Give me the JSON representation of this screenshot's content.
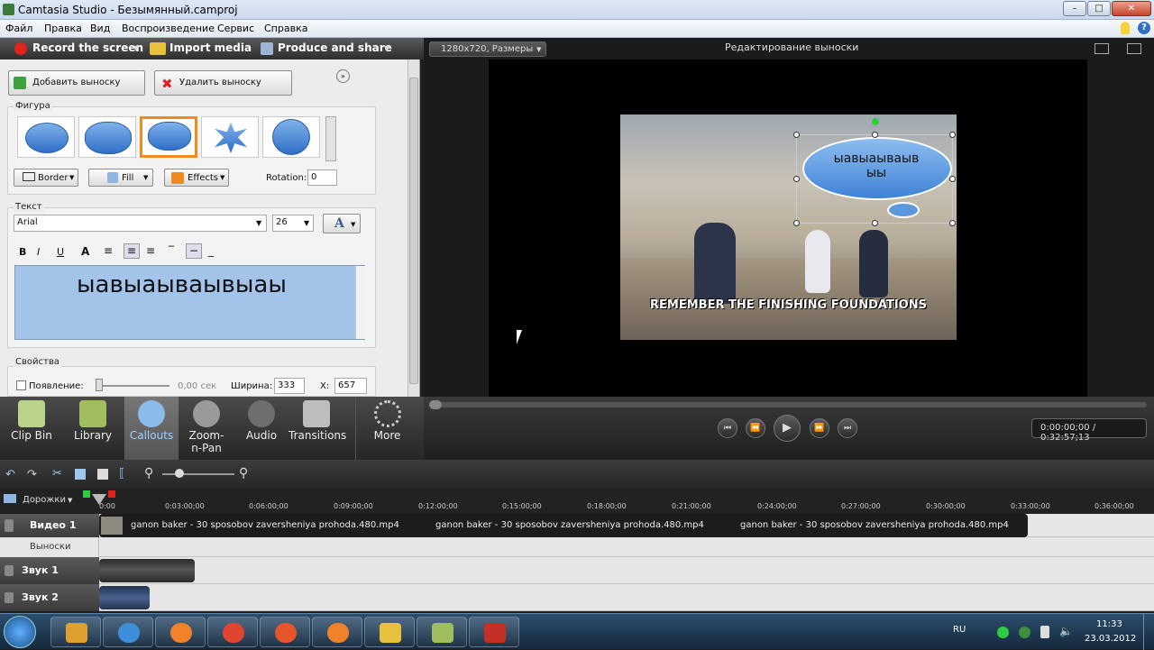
{
  "window": {
    "title": "Camtasia Studio - Безымянный.camproj"
  },
  "menu": [
    "Файл",
    "Правка",
    "Вид",
    "Воспроизведение",
    "Сервис",
    "Справка"
  ],
  "toolbar": {
    "record": "Record the screen",
    "import": "Import media",
    "produce": "Produce and share"
  },
  "callouts": {
    "add": "Добавить выноску",
    "remove": "Удалить выноску",
    "shape_group": "Фигура",
    "border": "Border",
    "fill": "Fill",
    "effects": "Effects",
    "rotation_label": "Rotation:",
    "rotation_value": "0",
    "text_group": "Текст",
    "font": "Arial",
    "font_size": "26",
    "text_value": "ыавыаываывыаы",
    "props_group": "Свойства",
    "appear_label": "Появление:",
    "appear_value": "0,00 сек",
    "width_label": "Ширина:",
    "width_value": "333",
    "x_label": "X:",
    "x_value": "657"
  },
  "preview": {
    "dims": "1280x720, Размеры",
    "title": "Редактирование выноски",
    "callout_text": "ыавыаываыв ыы",
    "video_caption": "REMEMBER THE FINISHING FOUNDATIONS",
    "time": "0:00:00;00 / 0:32:57;13"
  },
  "tasks": [
    {
      "label": "Clip Bin",
      "color": "#b9d48a"
    },
    {
      "label": "Library",
      "color": "#9fbf5e"
    },
    {
      "label": "Callouts",
      "color": "#8bbbe8"
    },
    {
      "label": "Zoom-n-Pan",
      "color": "#9a9a9a"
    },
    {
      "label": "Audio",
      "color": "#6e6e6e"
    },
    {
      "label": "Transitions",
      "color": "#bdbdbd"
    },
    {
      "label": "More",
      "color": "#cccccc"
    }
  ],
  "timeline": {
    "tracks_label": "Дорожки",
    "ticks": [
      "0:00",
      "0:03:00;00",
      "0:06:00;00",
      "0:09:00;00",
      "0:12:00;00",
      "0:15:00;00",
      "0:18:00;00",
      "0:21:00;00",
      "0:24:00;00",
      "0:27:00;00",
      "0:30:00;00",
      "0:33:00;00",
      "0:36:00;00"
    ],
    "video1": "Видео 1",
    "callouts_track": "Выноски",
    "audio1": "Звук 1",
    "audio2": "Звук 2",
    "clip_name": "ganon baker - 30 sposobov zaversheniya prohoda.480.mp4"
  },
  "taskbar": {
    "lang": "RU",
    "time": "11:33",
    "date": "23.03.2012"
  }
}
